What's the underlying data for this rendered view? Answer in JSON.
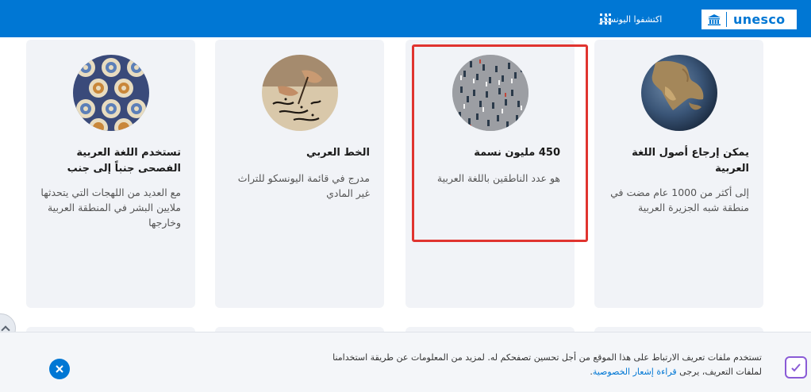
{
  "header": {
    "logo_text": "unesco",
    "discover_label": "اكتشفوا اليونسكو",
    "bar_color": "#0077d4"
  },
  "cards": [
    {
      "title": "يمكن إرجاع أصول اللغة العربية",
      "description": "إلى أكثر من 1000 عام مضت في منطقة شبه الجزيرة العربية",
      "image": "earth-arabian-peninsula"
    },
    {
      "title": "450 مليون نسمة",
      "description": "هو عدد الناطقين باللغة العربية",
      "image": "crowd-aerial"
    },
    {
      "title": "الخط العربي",
      "description": "مدرج في قائمة اليونسكو للتراث غير المادي",
      "image": "calligraphy-hands"
    },
    {
      "title": "تستخدم اللغة العربية الفصحى جنباً إلى جنب",
      "description": "مع العديد من اللهجات التي يتحدثها ملايين البشر في المنطقة العربية وخارجها",
      "image": "islamic-pattern"
    }
  ],
  "cookie_banner": {
    "text": "تستخدم ملفات تعريف الارتباط على هذا الموقع من أجل تحسين تصفحكم له. لمزيد من المعلومات عن طريقة استخدامنا لملفات التعريف، يرجى",
    "link_text": "قراءة إشعار الخصوصية"
  },
  "colors": {
    "accent": "#0077d4",
    "highlight": "#e0342f",
    "card_bg": "#f1f3f7"
  }
}
